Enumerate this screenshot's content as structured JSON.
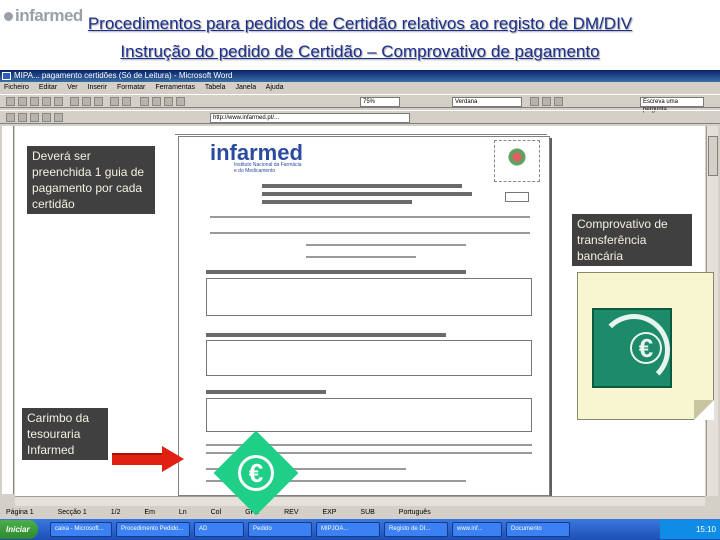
{
  "slide": {
    "logo_text": "infarmed",
    "title_line1": "Procedimentos para pedidos de Certidão relativos ao registo de DM/DIV",
    "title_line2": "Instrução do pedido de Certidão – Comprovativo de pagamento"
  },
  "word_window": {
    "title": "MIPA... pagamento certidões (Só de Leitura) - Microsoft Word",
    "menu": [
      "Ficheiro",
      "Editar",
      "Ver",
      "Inserir",
      "Formatar",
      "Ferramentas",
      "Tabela",
      "Janela",
      "Ajuda"
    ],
    "font_combo": "Verdana",
    "zoom_combo": "75%",
    "address_combo": "http://www.infarmed.pt/...",
    "help_box": "Escreva uma pergunta",
    "status": [
      "Página 1",
      "Secção 1",
      "1/2",
      "Em",
      "Ln",
      "Col",
      "GRV",
      "REV",
      "EXP",
      "SUB",
      "Português"
    ]
  },
  "document": {
    "logo_text": "infarmed",
    "logo_subtitle": "Instituto Nacional da Farmácia e do Medicamento"
  },
  "callouts": {
    "guia": "Deverá ser preenchida 1 guia de pagamento por cada certidão",
    "carimbo": "Carimbo da tesouraria Infarmed",
    "comprovativo": "Comprovativo de transferência bancária"
  },
  "taskbar": {
    "start_label": "Iniciar",
    "items": [
      "caixa - Microsoft...",
      "Procedimento Pedido...",
      "AD",
      "Pedido",
      "MIPJOA...",
      "Registo de DI...",
      "www.inf...",
      "Documento"
    ],
    "clock": "15:10"
  },
  "colors": {
    "title_blue": "#1c2f8f",
    "callout_bg": "#404040",
    "arrow_red": "#e02010",
    "euro_green": "#1fcf88"
  }
}
